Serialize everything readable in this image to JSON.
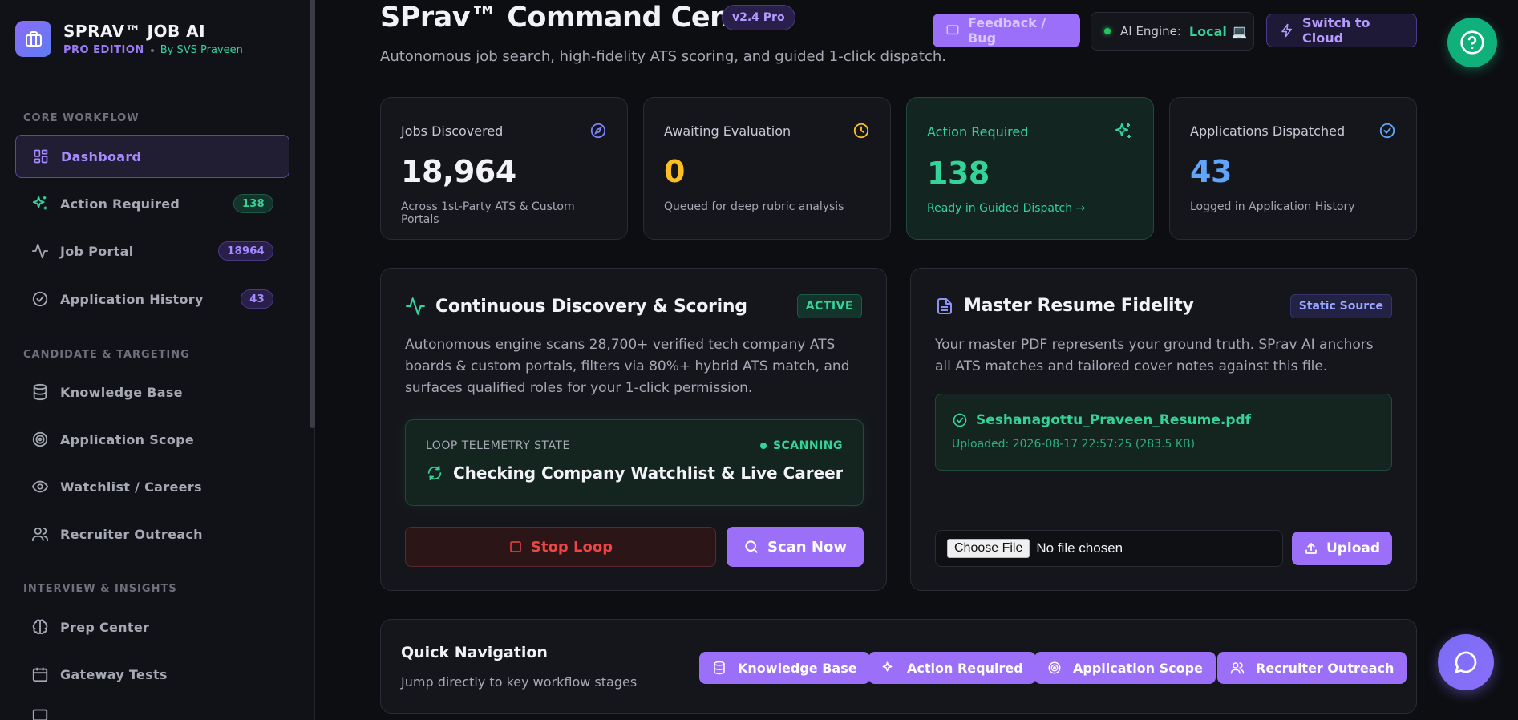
{
  "sidebar": {
    "brand_title": "SPRAV™ JOB AI",
    "edition": "PRO EDITION",
    "byline": "By SVS Praveen",
    "sections": {
      "core": "CORE WORKFLOW",
      "candidate": "CANDIDATE & TARGETING",
      "interview": "INTERVIEW & INSIGHTS"
    },
    "items": [
      {
        "label": "Dashboard",
        "icon": "dashboard-icon"
      },
      {
        "label": "Action Required",
        "icon": "sparkles-icon",
        "badge": "138"
      },
      {
        "label": "Job Portal",
        "icon": "activity-icon",
        "badge": "18964"
      },
      {
        "label": "Application History",
        "icon": "check-circle-icon",
        "badge": "43"
      },
      {
        "label": "Knowledge Base",
        "icon": "database-icon"
      },
      {
        "label": "Application Scope",
        "icon": "target-icon"
      },
      {
        "label": "Watchlist / Careers",
        "icon": "eye-icon"
      },
      {
        "label": "Recruiter Outreach",
        "icon": "users-icon"
      },
      {
        "label": "Prep Center",
        "icon": "brain-icon"
      },
      {
        "label": "Gateway Tests",
        "icon": "calendar-icon"
      }
    ]
  },
  "header": {
    "title": "SPrav™ Command Center",
    "version": "v2.4 Pro",
    "subtitle": "Autonomous job search, high-fidelity ATS scoring, and guided 1-click dispatch.",
    "feedback_label": "Feedback / Bug",
    "ai_engine_label": "AI Engine:",
    "ai_engine_value": "Local 💻",
    "switch_label": "Switch to Cloud"
  },
  "stats": [
    {
      "label": "Jobs Discovered",
      "value": "18,964",
      "note": "Across 1st-Party ATS & Custom Portals",
      "color": "#f3f3f7"
    },
    {
      "label": "Awaiting Evaluation",
      "value": "0",
      "note": "Queued for deep rubric analysis",
      "color": "#fbbf24"
    },
    {
      "label": "Action Required",
      "value": "138",
      "note": "Ready in Guided Dispatch →",
      "color": "#34d399"
    },
    {
      "label": "Applications Dispatched",
      "value": "43",
      "note": "Logged in Application History",
      "color": "#60a5fa"
    }
  ],
  "discovery": {
    "title": "Continuous Discovery & Scoring",
    "tag": "ACTIVE",
    "description": "Autonomous engine scans 28,700+ verified tech company ATS boards & custom portals, filters via 80%+ hybrid ATS match, and surfaces qualified roles for your 1-click permission.",
    "telemetry_label": "LOOP TELEMETRY STATE",
    "telemetry_status": "SCANNING",
    "telemetry_message": "Checking Company Watchlist & Live Careers...",
    "stop_label": "Stop Loop",
    "scan_label": "Scan Now"
  },
  "resume": {
    "title": "Master Resume Fidelity",
    "tag": "Static Source",
    "description": "Your master PDF represents your ground truth. SPrav AI anchors all ATS matches and tailored cover notes against this file.",
    "file_name": "Seshanagottu_Praveen_Resume.pdf",
    "file_meta": "Uploaded: 2026-08-17 22:57:25 (283.5 KB)",
    "choose_label": "Choose File",
    "no_file_label": "No file chosen",
    "upload_label": "Upload"
  },
  "quicknav": {
    "title": "Quick Navigation",
    "subtitle": "Jump directly to key workflow stages",
    "buttons": [
      "Knowledge Base",
      "Action Required",
      "Application Scope",
      "Recruiter Outreach"
    ]
  },
  "colors": {
    "accent": "#9b6ff8",
    "success": "#34d399",
    "warning": "#fbbf24",
    "info": "#60a5fa",
    "danger": "#ef4444"
  }
}
